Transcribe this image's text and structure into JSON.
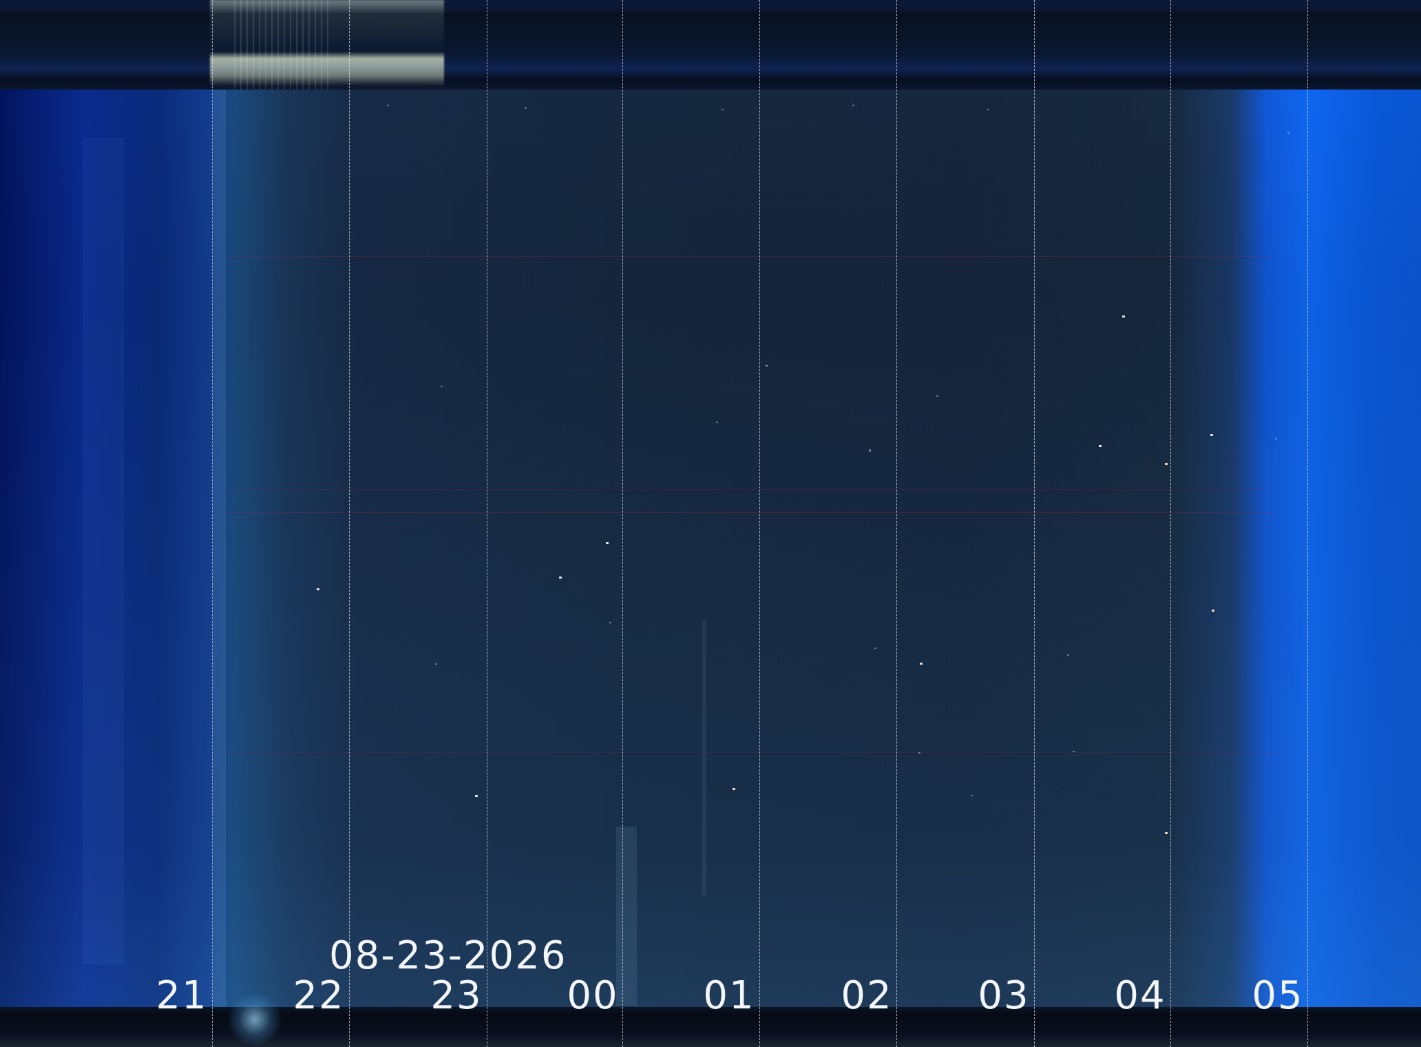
{
  "keogram": {
    "date_label": "08-23-2026",
    "hour_labels": [
      "21",
      "22",
      "23",
      "00",
      "01",
      "02",
      "03",
      "04",
      "05"
    ]
  },
  "colors": {
    "twilight_blue": "#0e66f0",
    "night_sky": "#16263d",
    "label_text": "#f4f6fb"
  }
}
